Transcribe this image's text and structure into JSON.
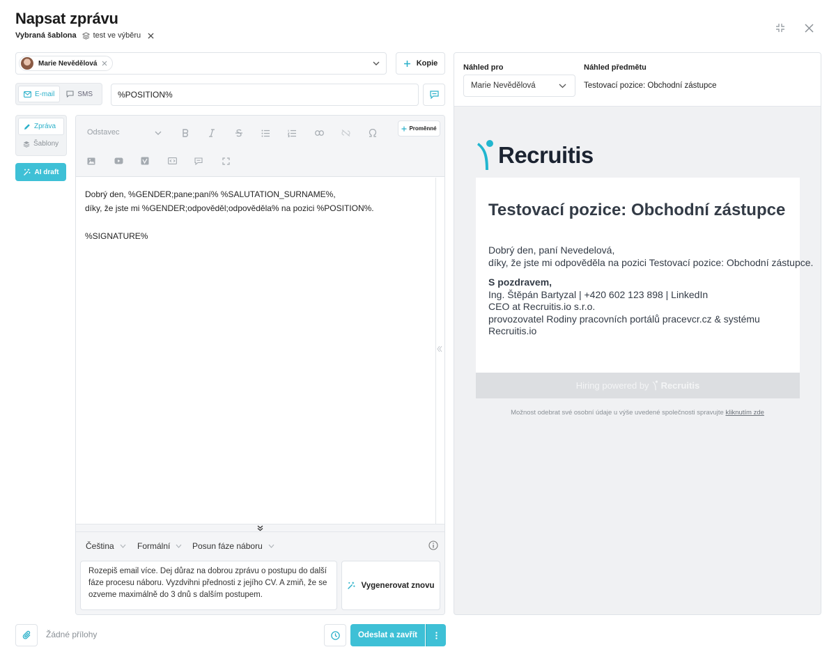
{
  "header": {
    "title": "Napsat zprávu",
    "template_label": "Vybraná šablona",
    "template_name": "test ve výběru"
  },
  "recipients": [
    {
      "name": "Marie Nevědělová"
    }
  ],
  "copy_button": "Kopie",
  "channel_tabs": [
    {
      "label": "E-mail",
      "active": true
    },
    {
      "label": "SMS",
      "active": false
    }
  ],
  "subject_value": "%POSITION%",
  "side_tabs": [
    {
      "label": "Zpráva",
      "active": true
    },
    {
      "label": "Šablony",
      "active": false
    }
  ],
  "ai_draft_button": "AI draft",
  "editor": {
    "format_select": "Odstavec",
    "variables_button": "Proměnné",
    "body_lines": [
      "Dobrý den, %GENDER;pane;paní% %SALUTATION_SURNAME%,",
      "díky, že jste mi %GENDER;odpověděl;odpověděla% na pozici %POSITION%.",
      "",
      "%SIGNATURE%"
    ]
  },
  "ai_panel": {
    "language": "Čeština",
    "tone": "Formální",
    "action": "Posun fáze náboru",
    "prompt": "Rozepiš email více. Dej důraz na dobrou zprávu o postupu do další fáze procesu náboru. Vyzdvihni přednosti z jejího CV. A zmiň, že se ozveme maximálně do 3 dnů s dalším postupem.",
    "regenerate_button": "Vygenerovat znovu"
  },
  "footer": {
    "no_attachments": "Žádné přílohy",
    "send_button": "Odeslat a zavřít"
  },
  "preview": {
    "for_label": "Náhled pro",
    "for_value": "Marie Nevědělová",
    "subject_label": "Náhled předmětu",
    "subject_value": "Testovací pozice: Obchodní zástupce",
    "logo_text": "Recruitis",
    "email_title": "Testovací pozice: Obchodní zástupce",
    "greeting_lines": [
      "Dobrý den, paní Nevedelová,",
      "díky, že jste mi odpověděla na pozici Testovací pozice: Obchodní zástupce."
    ],
    "signature_heading": "S pozdravem,",
    "signature_lines": [
      "Ing. Štěpán Bartyzal | +420 602 123 898 | LinkedIn",
      "CEO at Recruitis.io s.r.o.",
      "provozovatel Rodiny pracovních portálů pracevcr.cz & systému",
      "Recruitis.io"
    ],
    "powered_by": "Hiring powered by",
    "powered_brand": "Recruitis",
    "unsubscribe_text": "Možnost odebrat své osobní údaje u výše uvedené společnosti spravujte",
    "unsubscribe_link": "kliknutím zde"
  },
  "colors": {
    "accent": "#3ec0d6",
    "accent_text": "#2ab0c9"
  }
}
